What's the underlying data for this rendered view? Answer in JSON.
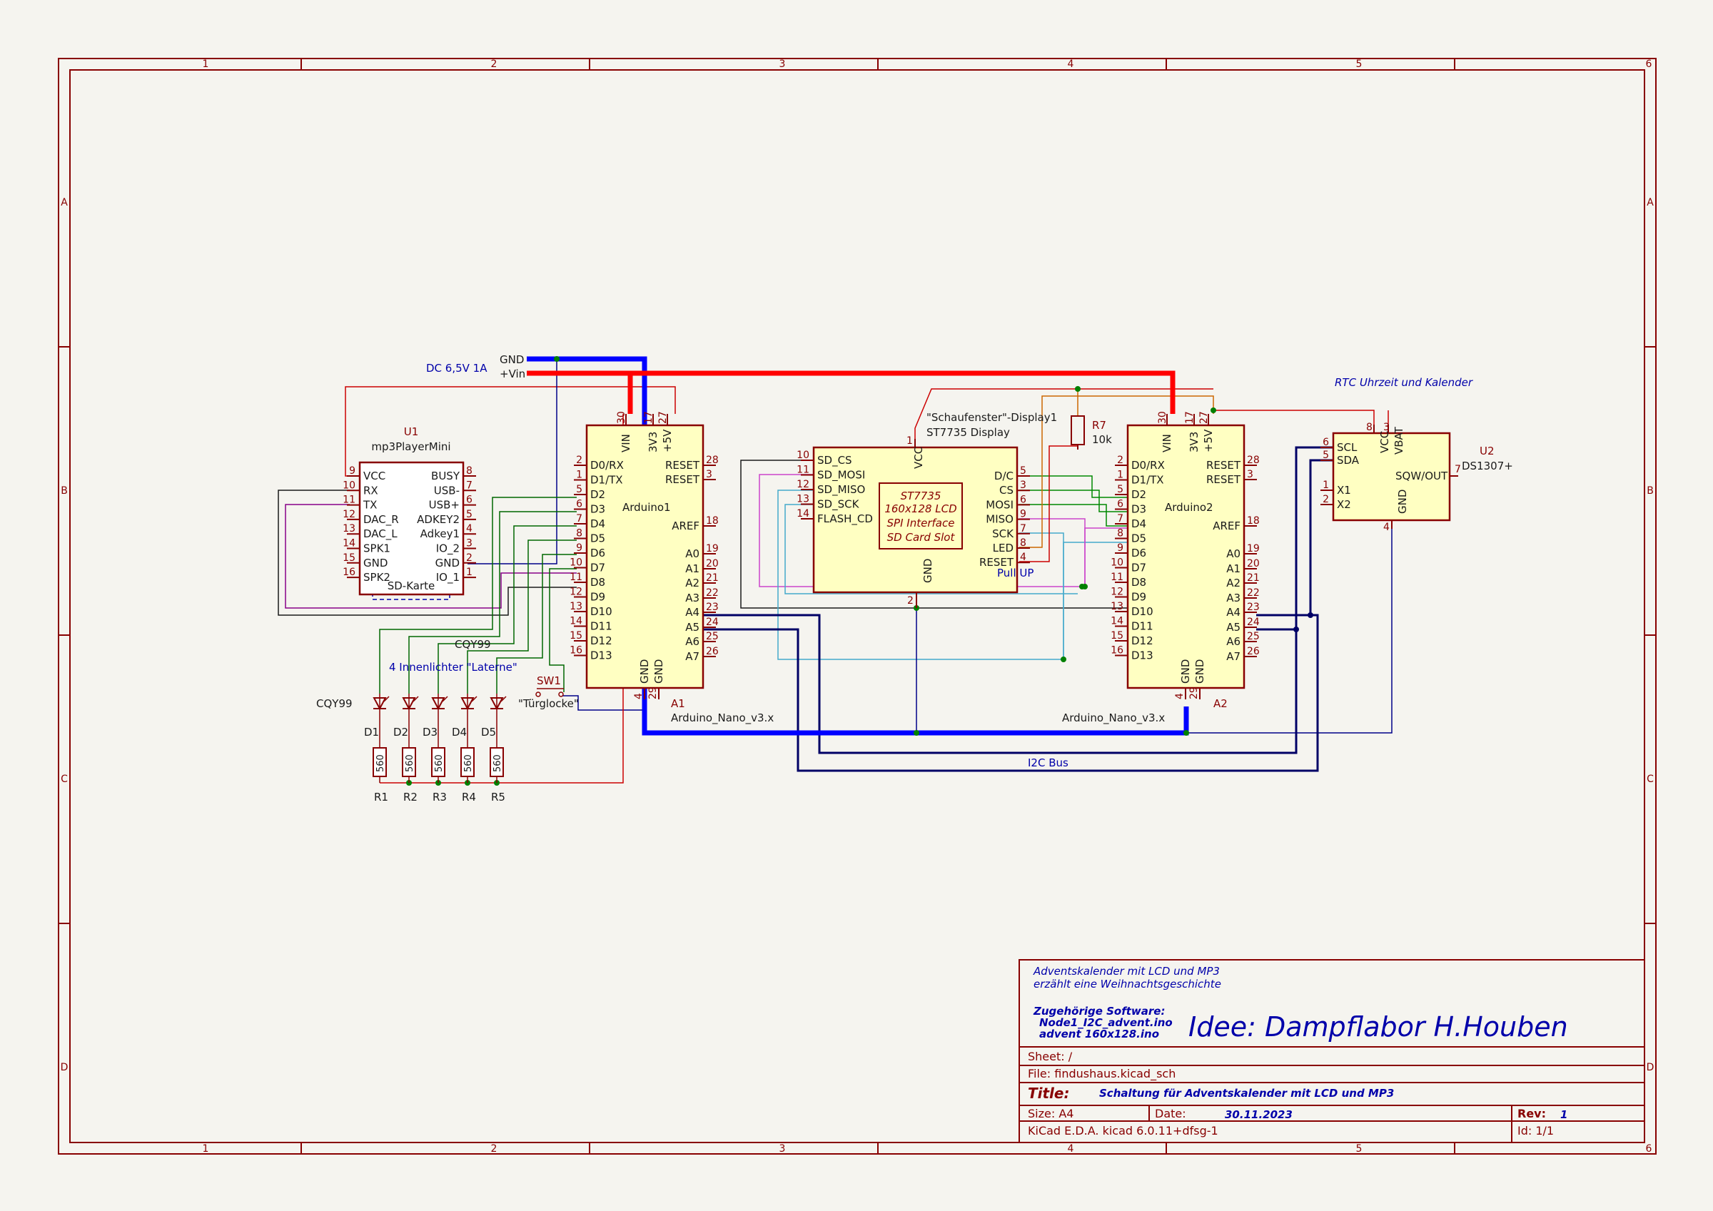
{
  "frame": {
    "columns": [
      "1",
      "2",
      "3",
      "4",
      "5",
      "6"
    ],
    "rows": [
      "A",
      "B",
      "C",
      "D"
    ]
  },
  "power": {
    "gnd_label": "GND",
    "vin_label": "+Vin",
    "supply_label": "DC 6,5V 1A"
  },
  "u1": {
    "ref": "U1",
    "value": "mp3PlayerMini",
    "left_pins": [
      {
        "num": "9",
        "name": "VCC"
      },
      {
        "num": "10",
        "name": "RX"
      },
      {
        "num": "11",
        "name": "TX"
      },
      {
        "num": "12",
        "name": "DAC_R"
      },
      {
        "num": "13",
        "name": "DAC_L"
      },
      {
        "num": "14",
        "name": "SPK1"
      },
      {
        "num": "15",
        "name": "GND"
      },
      {
        "num": "16",
        "name": "SPK2"
      }
    ],
    "right_pins": [
      {
        "num": "8",
        "name": "BUSY"
      },
      {
        "num": "7",
        "name": "USB-"
      },
      {
        "num": "6",
        "name": "USB+"
      },
      {
        "num": "5",
        "name": "ADKEY2"
      },
      {
        "num": "4",
        "name": "Adkey1"
      },
      {
        "num": "3",
        "name": "IO_2"
      },
      {
        "num": "2",
        "name": "GND"
      },
      {
        "num": "1",
        "name": "IO_1"
      }
    ],
    "sd_label": "SD-Karte"
  },
  "arduino1": {
    "ref": "A1",
    "value": "Arduino_Nano_v3.x",
    "name": "Arduino1",
    "top_pins": [
      {
        "num": "30",
        "name": "VIN"
      },
      {
        "num": "17",
        "name": "3V3"
      },
      {
        "num": "27",
        "name": "+5V"
      }
    ],
    "left_pins": [
      {
        "num": "2",
        "name": "D0/RX"
      },
      {
        "num": "1",
        "name": "D1/TX"
      },
      {
        "num": "5",
        "name": "D2"
      },
      {
        "num": "6",
        "name": "D3"
      },
      {
        "num": "7",
        "name": "D4"
      },
      {
        "num": "8",
        "name": "D5"
      },
      {
        "num": "9",
        "name": "D6"
      },
      {
        "num": "10",
        "name": "D7"
      },
      {
        "num": "11",
        "name": "D8"
      },
      {
        "num": "12",
        "name": "D9"
      },
      {
        "num": "13",
        "name": "D10"
      },
      {
        "num": "14",
        "name": "D11"
      },
      {
        "num": "15",
        "name": "D12"
      },
      {
        "num": "16",
        "name": "D13"
      }
    ],
    "right_pins": [
      {
        "num": "28",
        "name": "RESET"
      },
      {
        "num": "3",
        "name": "RESET"
      },
      {
        "num": "18",
        "name": "AREF"
      },
      {
        "num": "19",
        "name": "A0"
      },
      {
        "num": "20",
        "name": "A1"
      },
      {
        "num": "21",
        "name": "A2"
      },
      {
        "num": "22",
        "name": "A3"
      },
      {
        "num": "23",
        "name": "A4"
      },
      {
        "num": "24",
        "name": "A5"
      },
      {
        "num": "25",
        "name": "A6"
      },
      {
        "num": "26",
        "name": "A7"
      }
    ],
    "bottom_pins": [
      {
        "num": "4",
        "name": "GND"
      },
      {
        "num": "29",
        "name": "GND"
      }
    ]
  },
  "arduino2": {
    "ref": "A2",
    "value": "Arduino_Nano_v3.x",
    "name": "Arduino2"
  },
  "display": {
    "ref": "\"Schaufenster\"-Display1",
    "value": "ST7735 Display",
    "vcc_pin": {
      "num": "1",
      "name": "VCC"
    },
    "gnd_pin": {
      "num": "2",
      "name": "GND"
    },
    "left_pins": [
      {
        "num": "10",
        "name": "SD_CS"
      },
      {
        "num": "11",
        "name": "SD_MOSI"
      },
      {
        "num": "12",
        "name": "SD_MISO"
      },
      {
        "num": "13",
        "name": "SD_SCK"
      },
      {
        "num": "14",
        "name": "FLASH_CD"
      }
    ],
    "right_pins": [
      {
        "num": "5",
        "name": "D/C"
      },
      {
        "num": "3",
        "name": "CS"
      },
      {
        "num": "6",
        "name": "MOSI"
      },
      {
        "num": "9",
        "name": "MISO"
      },
      {
        "num": "7",
        "name": "SCK"
      },
      {
        "num": "8",
        "name": "LED"
      },
      {
        "num": "4",
        "name": "RESET"
      }
    ],
    "inner": [
      "ST7735",
      "160x128 LCD",
      "SPI Interface",
      "SD Card Slot"
    ]
  },
  "r7": {
    "ref": "R7",
    "value": "10k"
  },
  "pullup_label": "Pull UP",
  "u2": {
    "ref": "U2",
    "value": "DS1307+",
    "left_pins": [
      {
        "num": "6",
        "name": "SCL"
      },
      {
        "num": "5",
        "name": "SDA"
      },
      {
        "num": "1",
        "name": "X1"
      },
      {
        "num": "2",
        "name": "X2"
      }
    ],
    "top_pins": [
      {
        "num": "8",
        "name": "VCC"
      },
      {
        "num": "3",
        "name": "VBAT"
      }
    ],
    "right_pin": {
      "num": "7",
      "name": "SQW/OUT"
    },
    "bottom_pin": {
      "num": "4",
      "name": "GND"
    }
  },
  "rtc_label": "RTC Uhrzeit und Kalender",
  "leds": {
    "group_label": "4 Innenlichter \"Laterne\"",
    "type_label_a": "CQY99",
    "type_label_b": "CQY99",
    "refs": [
      "D1",
      "D2",
      "D3",
      "D4",
      "D5"
    ]
  },
  "resistors": {
    "refs": [
      "R1",
      "R2",
      "R3",
      "R4",
      "R5"
    ],
    "value": "560"
  },
  "switch": {
    "ref": "SW1",
    "label": "\"Türglocke\""
  },
  "i2c_label": "I2C Bus",
  "title_block": {
    "desc1": "Adventskalender mit LCD und MP3",
    "desc2": "erzählt eine Weihnachtsgeschichte",
    "sw_head": "Zugehörige Software:",
    "sw1": "Node1_I2C_advent.ino",
    "sw2": "advent 160x128.ino",
    "idea": "Idee: Dampflabor H.Houben",
    "sheet": "Sheet: /",
    "file": "File: findushaus.kicad_sch",
    "title_label": "Title:",
    "title": "Schaltung für Adventskalender mit LCD und MP3",
    "size": "Size: A4",
    "date_label": "Date:",
    "date": "30.11.2023",
    "rev_label": "Rev:",
    "rev": "1",
    "tool": "KiCad E.D.A.  kicad 6.0.11+dfsg-1",
    "id": "Id: 1/1"
  },
  "colors": {
    "frame": "#880000",
    "body": "#ffffc2",
    "wire_power": "#ff0000",
    "wire_gnd": "#0000ff",
    "wire_i2c": "#000066",
    "wire_green": "#008000"
  }
}
